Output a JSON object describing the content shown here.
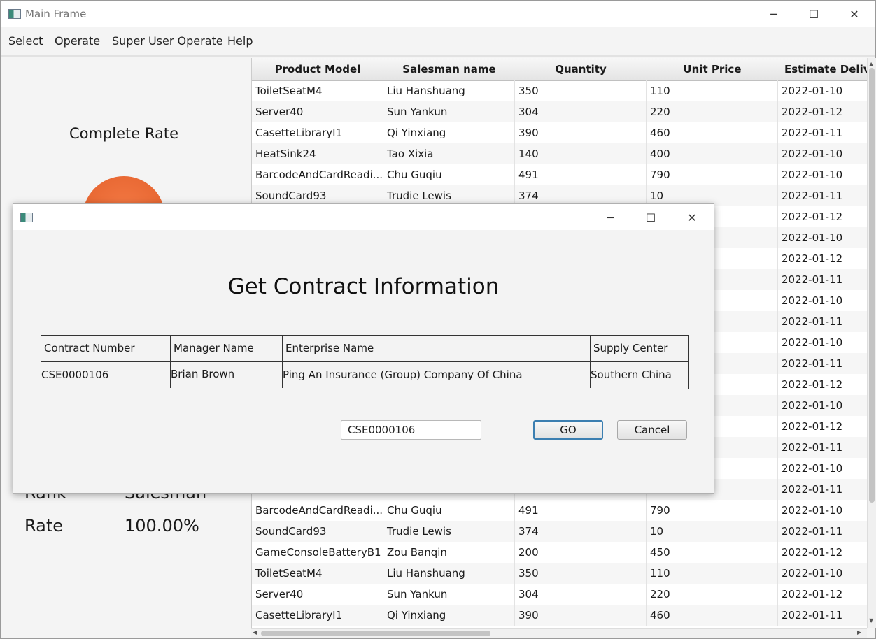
{
  "main_window": {
    "title": "Main Frame",
    "controls": {
      "minimize": "─",
      "maximize": "☐",
      "close": "✕"
    }
  },
  "menu": [
    "Select",
    "Operate",
    "Super User Operate",
    "Help"
  ],
  "left_panel": {
    "complete_rate_title": "Complete Rate",
    "rank_label": "Rank",
    "rank_value": "Salesman",
    "rate_label": "Rate",
    "rate_value": "100.00%",
    "pie_color": "#e9673a"
  },
  "table": {
    "columns": [
      "Product Model",
      "Salesman name",
      "Quantity",
      "Unit Price",
      "Estimate Delive"
    ],
    "rows": [
      [
        "ToiletSeatM4",
        "Liu Hanshuang",
        "350",
        "110",
        "2022-01-10"
      ],
      [
        "Server40",
        "Sun Yankun",
        "304",
        "220",
        "2022-01-12"
      ],
      [
        "CasetteLibraryI1",
        "Qi Yinxiang",
        "390",
        "460",
        "2022-01-11"
      ],
      [
        "HeatSink24",
        "Tao Xixia",
        "140",
        "400",
        "2022-01-10"
      ],
      [
        "BarcodeAndCardReadi...",
        "Chu Guqiu",
        "491",
        "790",
        "2022-01-10"
      ],
      [
        "SoundCard93",
        "Trudie Lewis",
        "374",
        "10",
        "2022-01-11"
      ],
      [
        "",
        "",
        "",
        "",
        "2022-01-12"
      ],
      [
        "",
        "",
        "",
        "",
        "2022-01-10"
      ],
      [
        "",
        "",
        "",
        "",
        "2022-01-12"
      ],
      [
        "",
        "",
        "",
        "",
        "2022-01-11"
      ],
      [
        "",
        "",
        "",
        "",
        "2022-01-10"
      ],
      [
        "",
        "",
        "",
        "",
        "2022-01-11"
      ],
      [
        "",
        "",
        "",
        "",
        "2022-01-10"
      ],
      [
        "",
        "",
        "",
        "",
        "2022-01-11"
      ],
      [
        "",
        "",
        "",
        "",
        "2022-01-12"
      ],
      [
        "",
        "",
        "",
        "",
        "2022-01-10"
      ],
      [
        "",
        "",
        "",
        "",
        "2022-01-12"
      ],
      [
        "",
        "",
        "",
        "",
        "2022-01-11"
      ],
      [
        "",
        "",
        "",
        "",
        "2022-01-10"
      ],
      [
        "",
        "",
        "",
        "",
        "2022-01-11"
      ],
      [
        "BarcodeAndCardReadi...",
        "Chu Guqiu",
        "491",
        "790",
        "2022-01-10"
      ],
      [
        "SoundCard93",
        "Trudie Lewis",
        "374",
        "10",
        "2022-01-11"
      ],
      [
        "GameConsoleBatteryB1",
        "Zou Banqin",
        "200",
        "450",
        "2022-01-12"
      ],
      [
        "ToiletSeatM4",
        "Liu Hanshuang",
        "350",
        "110",
        "2022-01-10"
      ],
      [
        "Server40",
        "Sun Yankun",
        "304",
        "220",
        "2022-01-12"
      ],
      [
        "CasetteLibraryI1",
        "Qi Yinxiang",
        "390",
        "460",
        "2022-01-11"
      ]
    ]
  },
  "dialog": {
    "controls": {
      "minimize": "─",
      "maximize": "☐",
      "close": "✕"
    },
    "title": "Get Contract Information",
    "info_headers": [
      "Contract Number",
      "Manager Name",
      "Enterprise Name",
      "Supply Center"
    ],
    "info_values": [
      "CSE0000106",
      "Brian Brown",
      "Ping An Insurance (Group) Company Of China",
      "Southern China"
    ],
    "input_value": "CSE0000106",
    "go_label": "GO",
    "cancel_label": "Cancel",
    "go_border_color": "#3c7fb1"
  }
}
